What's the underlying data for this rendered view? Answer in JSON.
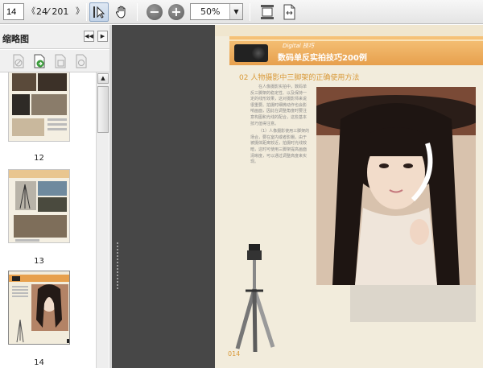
{
  "toolbar": {
    "page_input": "14",
    "nav_back": "《",
    "page_count": "24⁄ 201",
    "nav_fwd": "》",
    "zoom_value": "50%",
    "icons": [
      "select-tool-icon",
      "hand-tool-icon",
      "zoom-out-icon",
      "zoom-in-icon",
      "fit-page-icon",
      "fit-width-icon"
    ]
  },
  "thumbnails": {
    "title": "缩略图",
    "pages": [
      {
        "label": "12"
      },
      {
        "label": "13"
      },
      {
        "label": "14"
      }
    ]
  },
  "document": {
    "banner_en": "Digital 技巧",
    "banner_zh": "数码单反实拍技巧200例",
    "section_title": "02 人物摄影中三脚架的正确使用方法",
    "paragraph1": "在人像摄影实拍中，数码单反三脚架的稳定性、以及保持一定的线形效果，这对摄影师来说很重要。拍摄时细微动作也会影响画面，因此在调整角度时要注意构图和光线的配合，这些基本技巧值得注意。",
    "paragraph2": "（1）人像摄影使用三脚架的场合，要在室内或者影棚，由于被摄体距离较近，拍摄时光线较暗，这时可使用三脚架提高画面清晰度，可以通过调整高度来实现。",
    "page_number": "014"
  },
  "colors": {
    "accent": "#e7a04d",
    "page_bg": "#f2ecdc",
    "doc_bg": "#474747"
  }
}
